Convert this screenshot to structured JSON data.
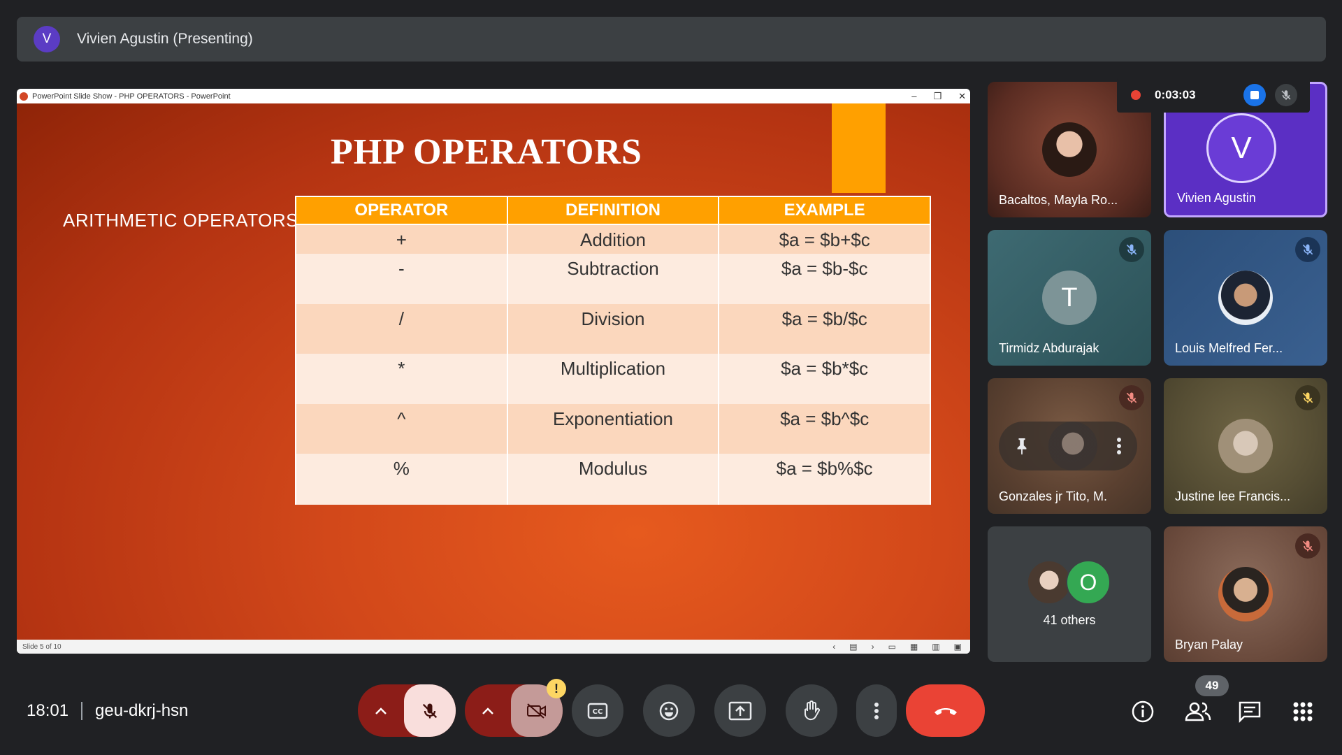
{
  "presenter": {
    "avatar_letter": "V",
    "label": "Vivien Agustin (Presenting)"
  },
  "ppt": {
    "window_title": "PowerPoint Slide Show  -  PHP OPERATORS - PowerPoint",
    "slide_title": "PHP OPERATORS",
    "subtitle": "ARITHMETIC OPERATORS",
    "table": {
      "headers": [
        "OPERATOR",
        "DEFINITION",
        "EXAMPLE"
      ],
      "rows": [
        [
          "+",
          "Addition",
          "$a = $b+$c"
        ],
        [
          "-",
          "Subtraction",
          "$a = $b-$c"
        ],
        [
          "/",
          "Division",
          "$a = $b/$c"
        ],
        [
          "*",
          "Multiplication",
          "$a = $b*$c"
        ],
        [
          "^",
          "Exponentiation",
          "$a = $b^$c"
        ],
        [
          "%",
          "Modulus",
          "$a = $b%$c"
        ]
      ]
    },
    "status": "Slide 5 of 10",
    "accent_color": "#ffa000"
  },
  "recording": {
    "time": "0:03:03",
    "status_color": "#ea4335"
  },
  "participants": [
    {
      "name": "Bacaltos, Mayla Ro...",
      "avatar": "photo-woman",
      "muted": false
    },
    {
      "name": "Vivien Agustin",
      "avatar_letter": "V",
      "muted": false
    },
    {
      "name": "Tirmidz Abdurajak",
      "avatar_letter": "T",
      "muted": true
    },
    {
      "name": "Louis Melfred Fer...",
      "avatar": "photo-man",
      "muted": true
    },
    {
      "name": "Gonzales jr Tito, M.",
      "avatar": "photo",
      "muted": true
    },
    {
      "name": "Justine lee Francis...",
      "avatar": "photo",
      "muted": true
    },
    {
      "name": "41 others",
      "avatar_letter": "O",
      "muted": false
    },
    {
      "name": "Bryan Palay",
      "avatar": "photo",
      "muted": true
    }
  ],
  "bottom": {
    "time": "18:01",
    "meeting_code": "geu-dkrj-hsn",
    "people_count": "49",
    "warning": "!"
  },
  "icons": [
    "mic-off-icon",
    "camera-off-icon",
    "captions-icon",
    "emoji-icon",
    "present-icon",
    "raise-hand-icon",
    "more-vert-icon",
    "end-call-icon",
    "info-icon",
    "people-icon",
    "chat-icon",
    "activities-icon",
    "pin-icon"
  ]
}
